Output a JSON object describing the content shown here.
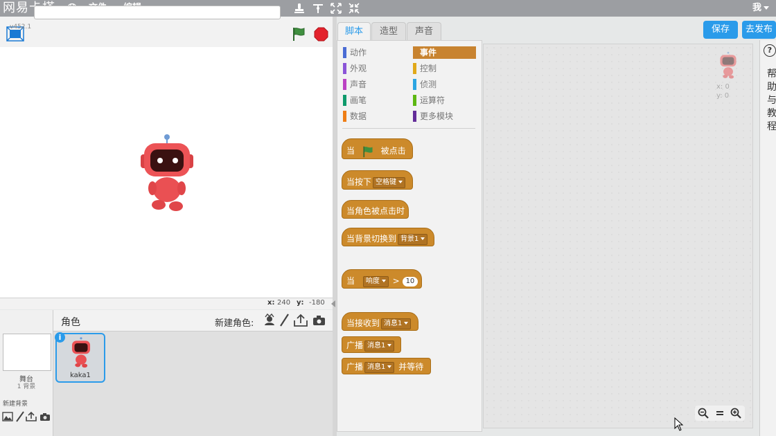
{
  "app": {
    "title": "网易卡搭",
    "version": "v452.1"
  },
  "menu": {
    "file": "文件",
    "edit": "编辑",
    "user": "我"
  },
  "project": {
    "name": ""
  },
  "stage": {
    "coords": {
      "x_label": "x:",
      "x_value": "240",
      "y_label": "y:",
      "y_value": "-180"
    }
  },
  "sprites": {
    "header": "角色",
    "new_sprite_label": "新建角色:",
    "stage_label": "舞台",
    "stage_count": "1 背景",
    "new_backdrop_label": "新建背景",
    "items": [
      {
        "name": "kaka1"
      }
    ]
  },
  "tabs": [
    {
      "label": "脚本"
    },
    {
      "label": "造型"
    },
    {
      "label": "声音"
    }
  ],
  "categories": [
    {
      "label": "动作",
      "color": "#4a6cd4"
    },
    {
      "label": "事件",
      "color": "#c88330"
    },
    {
      "label": "外观",
      "color": "#8a55d7"
    },
    {
      "label": "控制",
      "color": "#e1a91a"
    },
    {
      "label": "声音",
      "color": "#bb42c3"
    },
    {
      "label": "侦测",
      "color": "#2ca5e2"
    },
    {
      "label": "画笔",
      "color": "#0e9a6c"
    },
    {
      "label": "运算符",
      "color": "#5cb712"
    },
    {
      "label": "数据",
      "color": "#ee7d16"
    },
    {
      "label": "更多模块",
      "color": "#632d99"
    }
  ],
  "blocks": {
    "flag_clicked": {
      "pre": "当",
      "post": "被点击"
    },
    "key_pressed": {
      "pre": "当按下",
      "key": "空格键"
    },
    "sprite_clicked": {
      "text": "当角色被点击时"
    },
    "backdrop_switch": {
      "pre": "当背景切换到",
      "backdrop": "背景1"
    },
    "loudness": {
      "pre": "当",
      "sensor": "响度",
      "op": ">",
      "value": "10"
    },
    "receive": {
      "pre": "当接收到",
      "message": "消息1"
    },
    "broadcast": {
      "pre": "广播",
      "message": "消息1"
    },
    "broadcast_wait": {
      "pre": "广播",
      "message": "消息1",
      "post": "并等待"
    }
  },
  "toolbar": {
    "save": "保存",
    "publish": "去发布"
  },
  "help": {
    "icon": "?",
    "text": "帮助与教程"
  },
  "script_area": {
    "x_label": "x:",
    "x_value": "0",
    "y_label": "y:",
    "y_value": "0"
  }
}
